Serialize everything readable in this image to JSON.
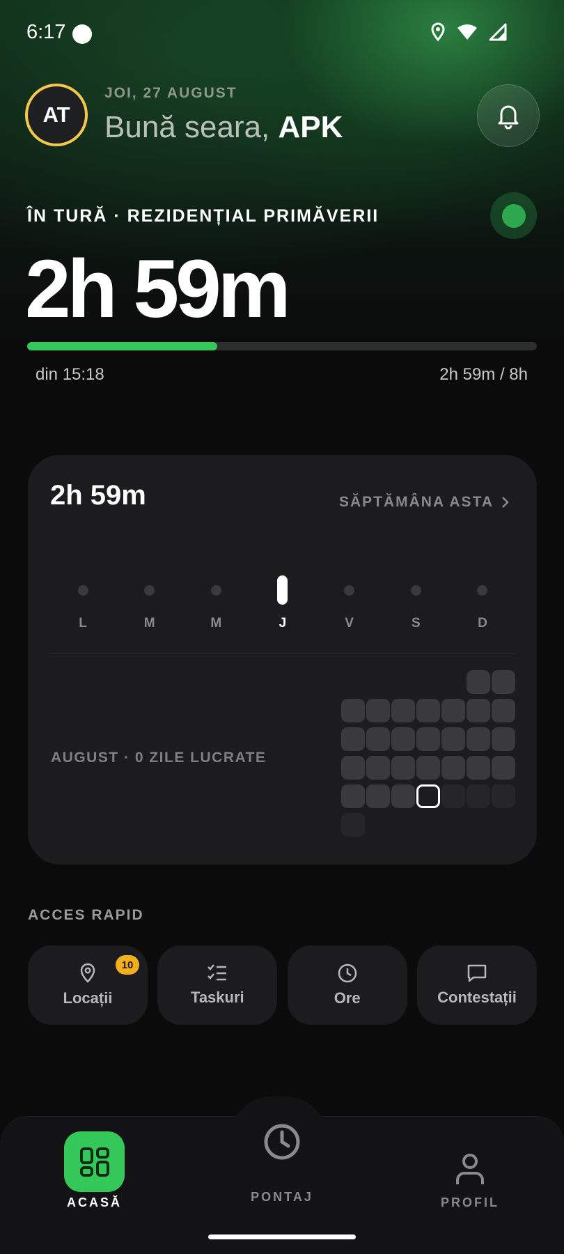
{
  "status_bar": {
    "time": "6:17",
    "icons": [
      "location-icon",
      "wifi-icon",
      "signal-icon"
    ]
  },
  "header": {
    "avatar_initials": "AT",
    "date": "JOI, 27 AUGUST",
    "greeting_prefix": "Bună seara,",
    "user_name": "APK",
    "bell_icon": "bell-icon"
  },
  "shift": {
    "label": "ÎN TURĂ · REZIDENȚIAL PRIMĂVERII",
    "elapsed": "2h 59m",
    "progress_fraction": 0.373,
    "since": "din 15:18",
    "ratio": "2h 59m / 8h",
    "colors": {
      "accent": "#34c85a",
      "live": "#2ea84f"
    }
  },
  "week_card": {
    "total": "2h 59m",
    "link_label": "SĂPTĂMÂNA ASTA",
    "days": [
      {
        "label": "L",
        "active": false
      },
      {
        "label": "M",
        "active": false
      },
      {
        "label": "M",
        "active": false
      },
      {
        "label": "J",
        "active": true
      },
      {
        "label": "V",
        "active": false
      },
      {
        "label": "S",
        "active": false
      },
      {
        "label": "D",
        "active": false
      }
    ],
    "month_label": "AUGUST · 0 ZILE LUCRATE",
    "calendar": {
      "leading_blanks": 5,
      "days_in_month": 31,
      "today": 27
    }
  },
  "quick_access": {
    "title": "ACCES RAPID",
    "items": [
      {
        "label": "Locații",
        "icon": "location-pin-icon",
        "badge": "10"
      },
      {
        "label": "Taskuri",
        "icon": "checklist-icon"
      },
      {
        "label": "Ore",
        "icon": "clock-icon"
      },
      {
        "label": "Contestații",
        "icon": "message-icon"
      }
    ]
  },
  "bottom_nav": {
    "items": [
      {
        "label": "ACASĂ",
        "icon": "dashboard-icon",
        "active": true
      },
      {
        "label": "PONTAJ",
        "icon": "clock-icon",
        "active": false
      },
      {
        "label": "PROFIL",
        "icon": "user-icon",
        "active": false
      }
    ]
  }
}
